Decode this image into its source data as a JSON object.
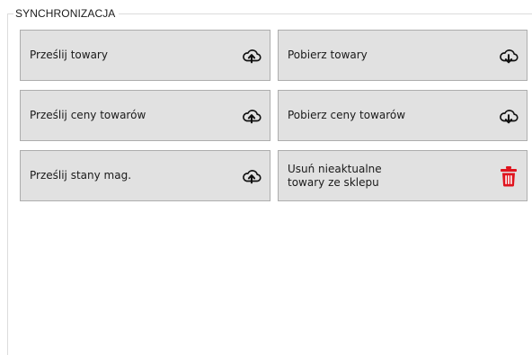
{
  "group": {
    "title": "SYNCHRONIZACJA"
  },
  "buttons": [
    {
      "label": "Prześlij towary",
      "icon": "cloud-upload-icon"
    },
    {
      "label": "Pobierz towary",
      "icon": "cloud-download-icon"
    },
    {
      "label": "Prześlij ceny towarów",
      "icon": "cloud-upload-icon"
    },
    {
      "label": "Pobierz ceny towarów",
      "icon": "cloud-download-icon"
    },
    {
      "label": "Prześlij stany mag.",
      "icon": "cloud-upload-icon"
    },
    {
      "label": "Usuń nieaktualne\ntowary ze sklepu",
      "icon": "trash-icon"
    }
  ],
  "colors": {
    "button_bg": "#e1e1e1",
    "button_border": "#adadad",
    "trash": "#e0141e"
  }
}
